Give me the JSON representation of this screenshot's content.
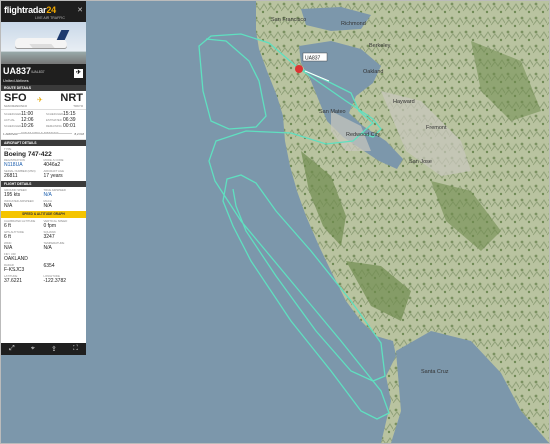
{
  "brand": {
    "name_a": "flightradar",
    "name_b": "24",
    "tagline": "LIVE AIR TRAFFIC"
  },
  "flight": {
    "id": "UA837",
    "callsign": "/UAL837",
    "airline": "United Airlines",
    "from_code": "SFO",
    "from_city": "SAN FRANCISCO",
    "to_code": "NRT",
    "to_city": "TOKYO",
    "times": [
      {
        "k1": "SCHEDULED",
        "v1": "11:00",
        "k2": "SCHEDULED",
        "v2": "15:15"
      },
      {
        "k1": "ACTUAL",
        "v1": "12:06",
        "k2": "ESTIMATED",
        "v2": "06:39"
      },
      {
        "k1": "SCHEDULED",
        "v1": "10:26",
        "k2": "REMAINING",
        "v2": "00:01"
      }
    ],
    "progress_left": "1 ARRIVAL",
    "progress_center": "GREAT CIRCLE DISTANCE",
    "progress_right": "8,2 KM"
  },
  "sections": {
    "route": "ROUTE DETAILS",
    "aircraft": "AIRCRAFT DETAILS",
    "flight": "FLIGHT DETAILS",
    "speed": "SPEED & ALTITUDE GRAPH"
  },
  "aircraft": {
    "type_label": "TYPE",
    "type": "Boeing 747-422",
    "fields": [
      {
        "k": "REGISTRATION",
        "v": "N118UA",
        "link": true
      },
      {
        "k": "MODE-S CODE",
        "v": "4046a2",
        "link": false
      },
      {
        "k": "SERIAL NUMBER (MSN)",
        "v": "26811",
        "link": false
      },
      {
        "k": "AIRCRAFT AGE",
        "v": "17 years",
        "link": false
      }
    ]
  },
  "details": [
    {
      "k": "GROUND SPEED",
      "v": "195 kts",
      "link": false
    },
    {
      "k": "TRUE AIRSPEED",
      "v": "N/A",
      "link": true
    },
    {
      "k": "INDICATED AIRSPEED",
      "v": "N/A",
      "link": false
    },
    {
      "k": "MACH",
      "v": "N/A",
      "link": false
    }
  ],
  "details2": [
    {
      "k": "CALIBRATED ALTITUDE",
      "v": "6 ft",
      "link": false
    },
    {
      "k": "VERTICAL SPEED",
      "v": "0 fpm",
      "link": false
    },
    {
      "k": "GPS ALTITUDE",
      "v": "6 ft",
      "link": false
    },
    {
      "k": "SQUAWK",
      "v": "3247",
      "link": false
    },
    {
      "k": "WIND",
      "v": "N/A",
      "link": false
    },
    {
      "k": "TEMPERATURE",
      "v": "N/A",
      "link": false
    },
    {
      "k": "FIR / UIR",
      "v": "OAKLAND",
      "link": false
    },
    {
      "k": "",
      "v": "",
      "link": false
    },
    {
      "k": "RADAR",
      "v": "F-KSJC3",
      "link": false
    },
    {
      "k": "",
      "v": "6354",
      "link": false
    },
    {
      "k": "LATITUDE",
      "v": "37.6221",
      "link": false
    },
    {
      "k": "LONGITUDE",
      "v": "-122.3782",
      "link": false
    }
  ],
  "map": {
    "labels": [
      {
        "name": "San Francisco"
      },
      {
        "name": "Oakland"
      },
      {
        "name": "San Mateo"
      },
      {
        "name": "San Jose"
      },
      {
        "name": "Hayward"
      },
      {
        "name": "Richmond"
      },
      {
        "name": "Berkeley"
      },
      {
        "name": "Fremont"
      },
      {
        "name": "Santa Cruz"
      },
      {
        "name": "Redwood City"
      }
    ],
    "marker_label": "UA837",
    "colors": {
      "ocean": "#7d98ab",
      "land": "#b8c59a",
      "track": "#5fe0c0"
    }
  }
}
